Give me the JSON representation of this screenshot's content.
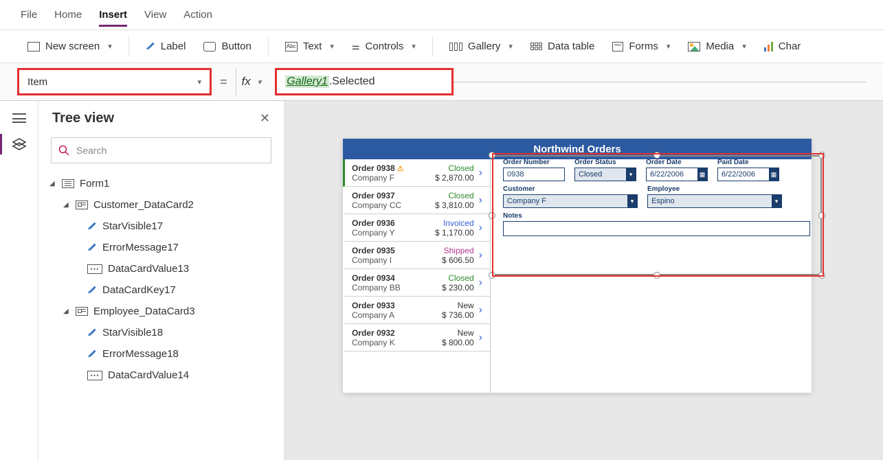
{
  "menu": {
    "file": "File",
    "home": "Home",
    "insert": "Insert",
    "view": "View",
    "action": "Action"
  },
  "ribbon": {
    "new_screen": "New screen",
    "label": "Label",
    "button": "Button",
    "text": "Text",
    "controls": "Controls",
    "gallery": "Gallery",
    "data_table": "Data table",
    "forms": "Forms",
    "media": "Media",
    "charts": "Char",
    "abc": "Abc"
  },
  "formula": {
    "property": "Item",
    "object": "Gallery1",
    "rest": ".Selected",
    "fx": "fx"
  },
  "tree": {
    "title": "Tree view",
    "search_ph": "Search",
    "nodes": {
      "form": "Form1",
      "cust_card": "Customer_DataCard2",
      "sv17": "StarVisible17",
      "em17": "ErrorMessage17",
      "dcv13": "DataCardValue13",
      "dck17": "DataCardKey17",
      "emp_card": "Employee_DataCard3",
      "sv18": "StarVisible18",
      "em18": "ErrorMessage18",
      "dcv14": "DataCardValue14"
    }
  },
  "app": {
    "title": "Northwind Orders"
  },
  "gallery": [
    {
      "order": "Order 0938",
      "warn": true,
      "company": "Company F",
      "status": "Closed",
      "cls": "closed",
      "amount": "$ 2,870.00",
      "sel": true
    },
    {
      "order": "Order 0937",
      "company": "Company CC",
      "status": "Closed",
      "cls": "closed",
      "amount": "$ 3,810.00"
    },
    {
      "order": "Order 0936",
      "company": "Company Y",
      "status": "Invoiced",
      "cls": "invoiced",
      "amount": "$ 1,170.00"
    },
    {
      "order": "Order 0935",
      "company": "Company I",
      "status": "Shipped",
      "cls": "shipped",
      "amount": "$ 606.50"
    },
    {
      "order": "Order 0934",
      "company": "Company BB",
      "status": "Closed",
      "cls": "closed",
      "amount": "$ 230.00"
    },
    {
      "order": "Order 0933",
      "company": "Company A",
      "status": "New",
      "cls": "new",
      "amount": "$ 736.00"
    },
    {
      "order": "Order 0932",
      "company": "Company K",
      "status": "New",
      "cls": "new",
      "amount": "$ 800.00"
    }
  ],
  "form": {
    "order_num_lbl": "Order Number",
    "order_num": "0938",
    "status_lbl": "Order Status",
    "status": "Closed",
    "order_date_lbl": "Order Date",
    "order_date": "6/22/2006",
    "paid_date_lbl": "Paid Date",
    "paid_date": "6/22/2006",
    "cust_lbl": "Customer",
    "cust": "Company F",
    "emp_lbl": "Employee",
    "emp": "Espino",
    "notes_lbl": "Notes",
    "notes": ""
  }
}
